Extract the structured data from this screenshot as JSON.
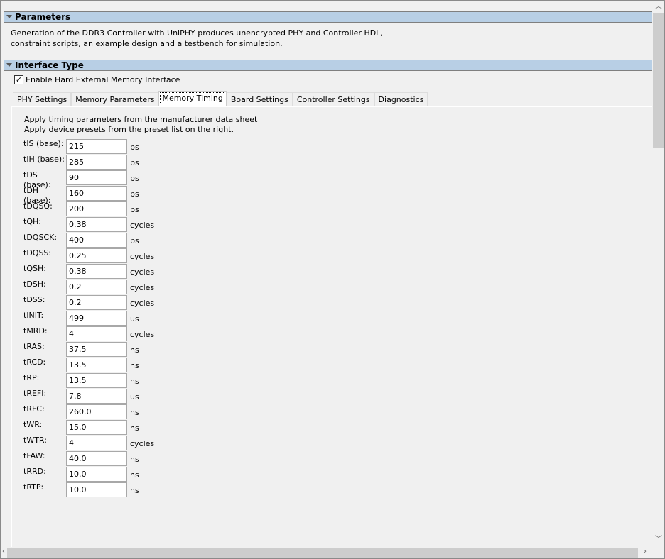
{
  "sections": {
    "parameters": "Parameters",
    "interface_type": "Interface Type"
  },
  "description": [
    "Generation of the DDR3 Controller with UniPHY produces unencrypted PHY and Controller HDL,",
    "constraint scripts, an example design and a testbench for simulation."
  ],
  "checkbox": {
    "label": "Enable Hard External Memory Interface",
    "checked": true
  },
  "tabs": [
    "PHY Settings",
    "Memory Parameters",
    "Memory Timing",
    "Board Settings",
    "Controller Settings",
    "Diagnostics"
  ],
  "active_tab": "Memory Timing",
  "intro": [
    "Apply timing parameters from the manufacturer data sheet",
    "Apply device presets from the preset list on the right."
  ],
  "params": [
    {
      "label": "tIS (base):",
      "value": "215",
      "unit": "ps"
    },
    {
      "label": "tIH (base):",
      "value": "285",
      "unit": "ps"
    },
    {
      "label": "tDS (base):",
      "value": "90",
      "unit": "ps"
    },
    {
      "label": "tDH (base):",
      "value": "160",
      "unit": "ps"
    },
    {
      "label": "tDQSQ:",
      "value": "200",
      "unit": "ps"
    },
    {
      "label": "tQH:",
      "value": "0.38",
      "unit": "cycles"
    },
    {
      "label": "tDQSCK:",
      "value": "400",
      "unit": "ps"
    },
    {
      "label": "tDQSS:",
      "value": "0.25",
      "unit": "cycles"
    },
    {
      "label": "tQSH:",
      "value": "0.38",
      "unit": "cycles"
    },
    {
      "label": "tDSH:",
      "value": "0.2",
      "unit": "cycles"
    },
    {
      "label": "tDSS:",
      "value": "0.2",
      "unit": "cycles"
    },
    {
      "label": "tINIT:",
      "value": "499",
      "unit": "us"
    },
    {
      "label": "tMRD:",
      "value": "4",
      "unit": "cycles"
    },
    {
      "label": "tRAS:",
      "value": "37.5",
      "unit": "ns"
    },
    {
      "label": "tRCD:",
      "value": "13.5",
      "unit": "ns"
    },
    {
      "label": "tRP:",
      "value": "13.5",
      "unit": "ns"
    },
    {
      "label": "tREFI:",
      "value": "7.8",
      "unit": "us"
    },
    {
      "label": "tRFC:",
      "value": "260.0",
      "unit": "ns"
    },
    {
      "label": "tWR:",
      "value": "15.0",
      "unit": "ns"
    },
    {
      "label": "tWTR:",
      "value": "4",
      "unit": "cycles"
    },
    {
      "label": "tFAW:",
      "value": "40.0",
      "unit": "ns"
    },
    {
      "label": "tRRD:",
      "value": "10.0",
      "unit": "ns"
    },
    {
      "label": "tRTP:",
      "value": "10.0",
      "unit": "ns"
    }
  ]
}
